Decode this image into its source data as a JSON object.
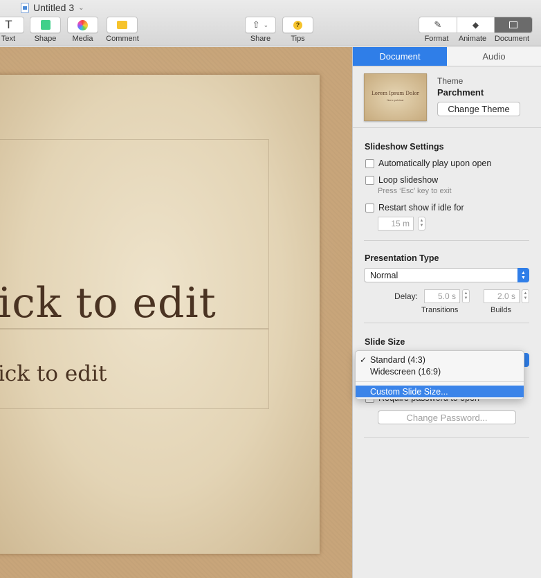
{
  "window": {
    "title": "Untitled 3"
  },
  "toolbar": {
    "text": "Text",
    "shape": "Shape",
    "media": "Media",
    "comment": "Comment",
    "share": "Share",
    "tips": "Tips",
    "format": "Format",
    "animate": "Animate",
    "document": "Document"
  },
  "slide": {
    "title": "ick to edit",
    "subtitle": "ick to edit"
  },
  "inspector": {
    "tabs": [
      "Document",
      "Audio"
    ],
    "theme_label": "Theme",
    "theme_name": "Parchment",
    "theme_thumb_title": "Lorem Ipsum Dolor",
    "theme_thumb_sub": "Nunc pulvinar",
    "change_theme": "Change Theme",
    "slideshow_heading": "Slideshow Settings",
    "auto_play": "Automatically play upon open",
    "loop": "Loop slideshow",
    "loop_note": "Press ‘Esc’ key to exit",
    "restart": "Restart show if idle for",
    "idle_value": "15 m",
    "presentation_heading": "Presentation Type",
    "presentation_value": "Normal",
    "delay_label": "Delay:",
    "transitions_value": "5.0 s",
    "builds_value": "2.0 s",
    "transitions_label": "Transitions",
    "builds_label": "Builds",
    "slide_size_heading": "Slide Size",
    "require_password": "Require password to open",
    "change_password": "Change Password..."
  },
  "slide_size_menu": {
    "options": [
      "Standard (4:3)",
      "Widescreen (16:9)"
    ],
    "checked": "Standard (4:3)",
    "custom": "Custom Slide Size..."
  },
  "colors": {
    "accent": "#2f7ee8",
    "menu_highlight": "#3b84e9",
    "slide_text": "#4a3322"
  }
}
